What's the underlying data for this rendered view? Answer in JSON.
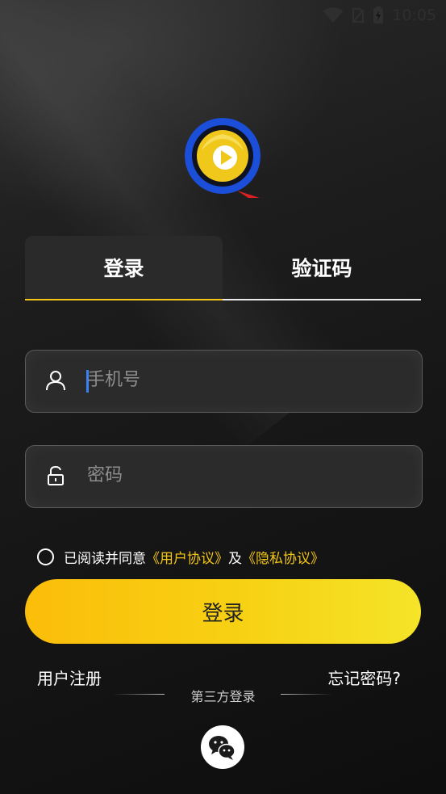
{
  "status_bar": {
    "time": "10:05",
    "icons": [
      "wifi-icon",
      "no-sim-icon",
      "battery-icon"
    ]
  },
  "tabs": [
    {
      "label": "登录",
      "active": true
    },
    {
      "label": "验证码",
      "active": false
    }
  ],
  "phone_field": {
    "placeholder": "手机号",
    "icon": "user-icon"
  },
  "password_field": {
    "placeholder": "密码",
    "icon": "lock-icon"
  },
  "agreement": {
    "prefix": "已阅读并同意",
    "user_agreement": "《用户协议》",
    "joiner": "及",
    "privacy_policy": "《隐私协议》",
    "checked": false
  },
  "login_button": "登录",
  "register_link": "用户注册",
  "forgot_link": "忘记密码?",
  "third_party": {
    "label": "第三方登录",
    "icon": "wechat-icon"
  },
  "colors": {
    "accent": "#f3c515",
    "button_start": "#fbbd0a",
    "button_end": "#f5e428",
    "caret": "#3b82f6"
  }
}
